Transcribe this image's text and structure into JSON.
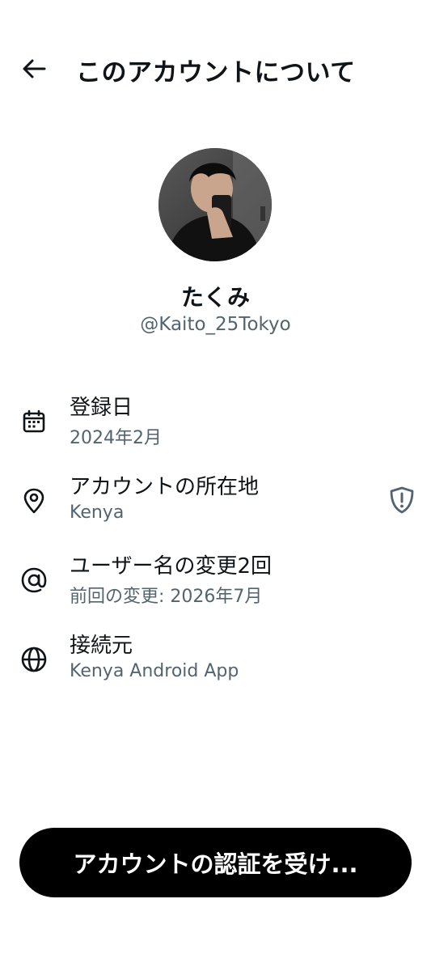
{
  "header": {
    "title": "このアカウントについて"
  },
  "profile": {
    "display_name": "たくみ",
    "handle": "@Kaito_25Tokyo"
  },
  "info": [
    {
      "icon": "calendar-icon",
      "label": "登録日",
      "value": "2024年2月"
    },
    {
      "icon": "location-pin-icon",
      "label": "アカウントの所在地",
      "value": "Kenya"
    },
    {
      "icon": "at-sign-icon",
      "label": "ユーザー名の変更2回",
      "value": "前回の変更: 2026年7月"
    },
    {
      "icon": "globe-icon",
      "label": "接続元",
      "value": "Kenya Android App"
    }
  ],
  "footer": {
    "verify_label": "アカウントの認証を受け..."
  },
  "colors": {
    "text_primary": "#0f1419",
    "text_secondary": "#536471",
    "button_bg": "#000000",
    "button_text": "#ffffff"
  }
}
